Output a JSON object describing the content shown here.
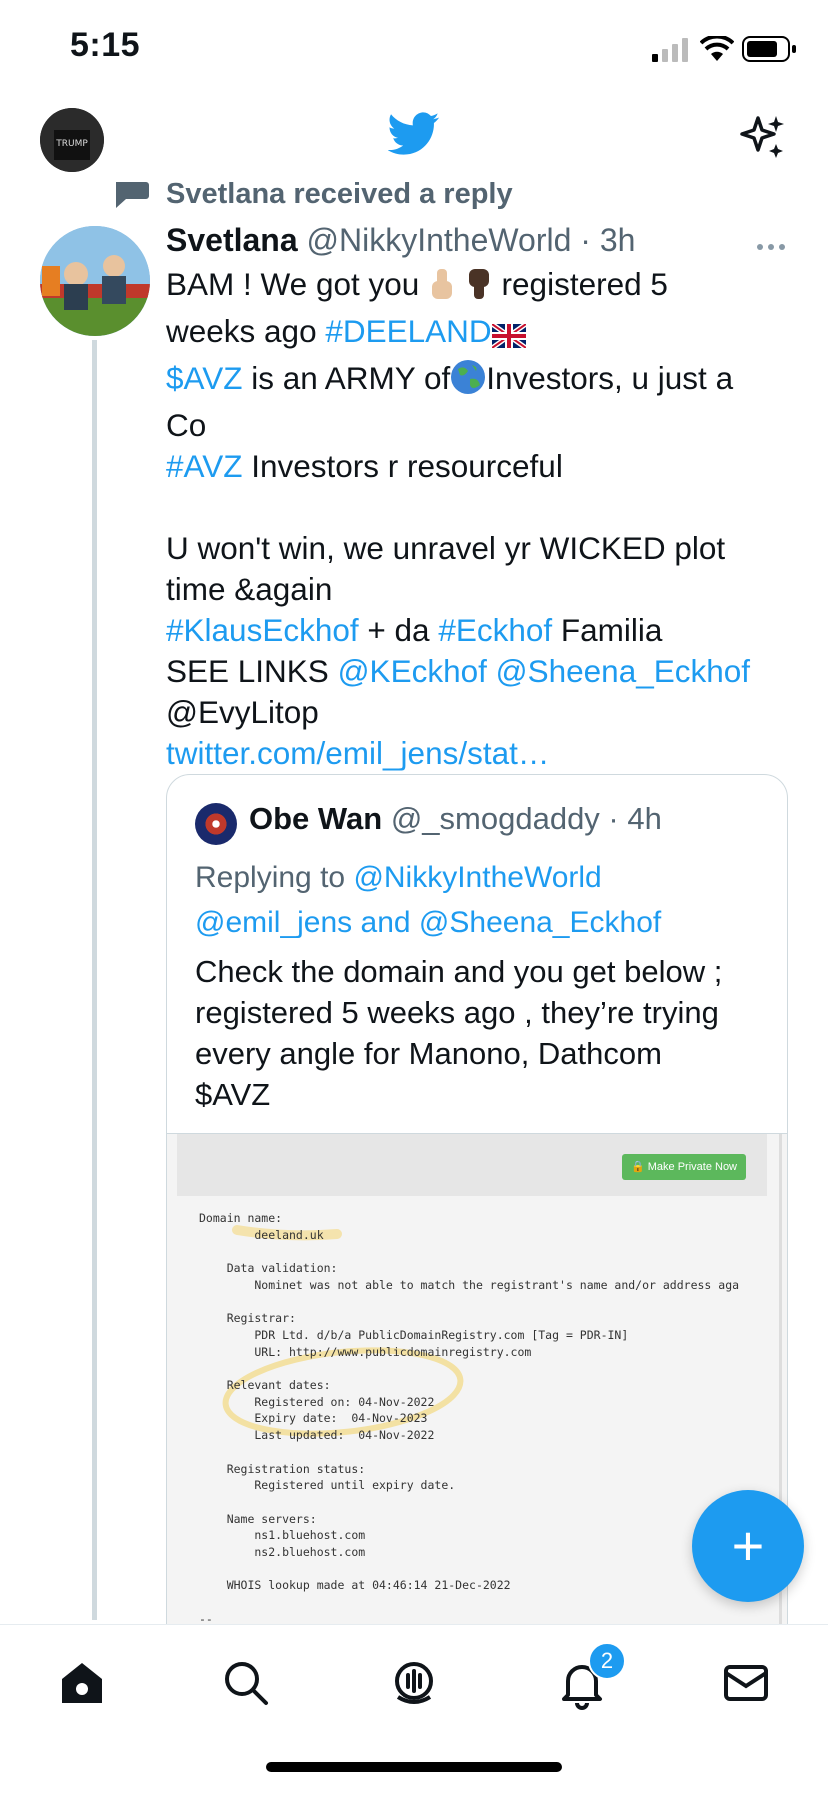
{
  "status_bar": {
    "time": "5:15"
  },
  "colors": {
    "accent": "#1d9bf0",
    "text": "#0f1419",
    "muted": "#536471"
  },
  "reply_context": {
    "text": "Svetlana received a reply"
  },
  "tweet": {
    "author_name": "Svetlana",
    "author_handle": "@NikkyIntheWorld",
    "separator": " · ",
    "time": "3h",
    "lines": {
      "l1a": "BAM !  We got you ",
      "l1b": " registered 5",
      "l2a": "weeks ago ",
      "l2_tag": "#DEELAND",
      "l3_tag": "$AVZ",
      "l3b": " is an ARMY of",
      "l3c": "Investors, u just a",
      "l4": "Co",
      "l5_tag": "#AVZ",
      "l5b": " Investors r resourceful",
      "l6": "U won't win, we unravel yr WICKED plot",
      "l7": "time &again",
      "l8_tag1": "#KlausEckhof",
      "l8b": " + da ",
      "l8_tag2": "#Eckhof",
      "l8c": " Familia",
      "l9a": "SEE LINKS ",
      "l9_m1": "@KEckhof",
      "l9_sp": " ",
      "l9_m2": "@Sheena_Eckhof",
      "l10": "@EvyLitop",
      "l11_link": "twitter.com/emil_jens/stat…"
    }
  },
  "quote": {
    "author_name": "Obe Wan",
    "author_handle": "@_smogdaddy",
    "separator": " · ",
    "time": "4h",
    "replying_prefix": "Replying to ",
    "replying_m1": "@NikkyIntheWorld",
    "replying_m2": "@emil_jens",
    "replying_and": " and ",
    "replying_m3": "@Sheena_Eckhof",
    "text_lines": [
      "Check the domain and you get below ;",
      "registered 5 weeks ago , they’re trying",
      "every angle for Manono, Dathcom",
      "$AVZ"
    ],
    "image": {
      "button_label": "Make Private Now",
      "whois_text": "Domain name:\n        deeland.uk\n\n    Data validation:\n        Nominet was not able to match the registrant's name and/or address aga\n\n    Registrar:\n        PDR Ltd. d/b/a PublicDomainRegistry.com [Tag = PDR-IN]\n        URL: http://www.publicdomainregistry.com\n\n    Relevant dates:\n        Registered on: 04-Nov-2022\n        Expiry date:  04-Nov-2023\n        Last updated:  04-Nov-2022\n\n    Registration status:\n        Registered until expiry date.\n\n    Name servers:\n        ns1.bluehost.com\n        ns2.bluehost.com\n\n    WHOIS lookup made at 04:46:14 21-Dec-2022\n\n--"
    }
  },
  "fab": {
    "icon": "+"
  },
  "nav": {
    "items": [
      "home-icon",
      "search-icon",
      "spaces-icon",
      "notifications-icon",
      "messages-icon"
    ],
    "notifications_badge": "2"
  }
}
